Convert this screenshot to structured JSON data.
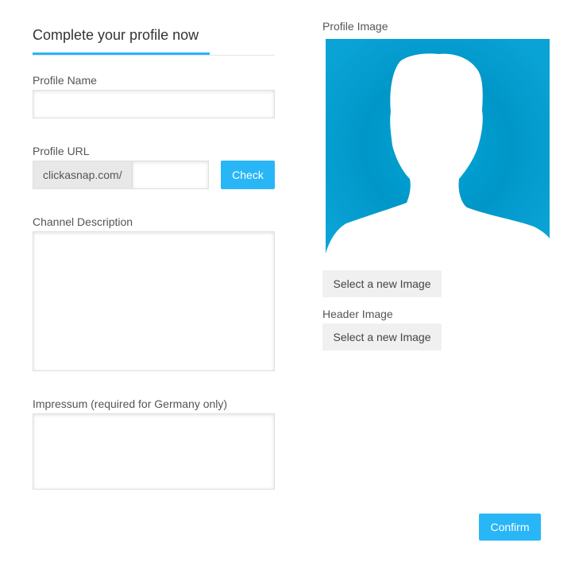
{
  "form": {
    "title": "Complete your profile now",
    "profile_name": {
      "label": "Profile Name",
      "value": "",
      "placeholder": ""
    },
    "profile_url": {
      "label": "Profile URL",
      "prefix": "clickasnap.com/",
      "value": "",
      "placeholder": "",
      "check_label": "Check"
    },
    "channel_description": {
      "label": "Channel Description",
      "value": ""
    },
    "impressum": {
      "label": "Impressum (required for Germany only)",
      "value": ""
    }
  },
  "images": {
    "profile_image_label": "Profile Image",
    "profile_placeholder_icon": "person-silhouette-icon",
    "profile_select_label": "Select a new Image",
    "header_image_label": "Header Image",
    "header_select_label": "Select a new Image"
  },
  "footer": {
    "confirm_label": "Confirm"
  },
  "colors": {
    "accent": "#29b6f6",
    "avatar_background": "#0099cc",
    "prefix_background": "#e8e8e8",
    "secondary_button": "#f0f0f0"
  }
}
